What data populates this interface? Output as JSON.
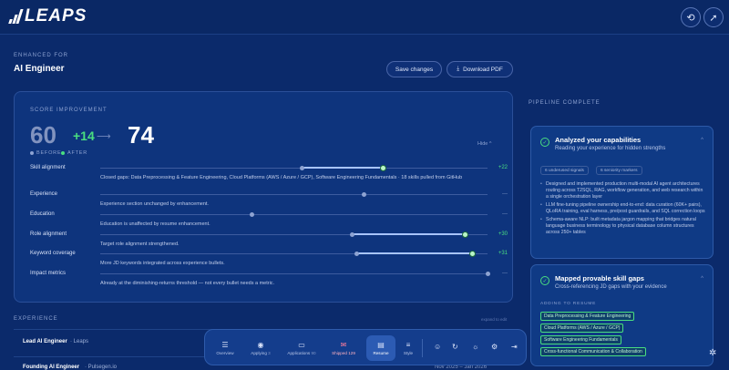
{
  "app": {
    "logo_text": "LEAPS"
  },
  "header": {
    "action1_icon": "refresh-icon",
    "action2_icon": "rocket-icon"
  },
  "page": {
    "eyebrow": "ENHANCED FOR",
    "role": "AI Engineer",
    "save_label": "Save changes",
    "download_label": "Download PDF"
  },
  "score": {
    "label": "SCORE IMPROVEMENT",
    "before": "60",
    "delta": "+14",
    "after": "74",
    "legend_before": "BEFORE",
    "legend_after": "AFTER",
    "hide_label": "Hide",
    "colors": {
      "before": "#8ea3d2",
      "after": "#4ade80"
    }
  },
  "metrics": [
    {
      "name": "Skill alignment",
      "before": 0.52,
      "after": 0.73,
      "delta": "+22",
      "note": "Closed gaps: Data Preprocessing & Feature Engineering, Cloud Platforms (AWS / Azure / GCP), Software Engineering Fundamentals · 18 skills pulled from GitHub"
    },
    {
      "name": "Experience",
      "before": 0.68,
      "after": null,
      "delta": "—",
      "note": "Experience section unchanged by enhancement."
    },
    {
      "name": "Education",
      "before": 0.39,
      "after": null,
      "delta": "—",
      "note": "Education is unaffected by resume enhancement."
    },
    {
      "name": "Role alignment",
      "before": 0.65,
      "after": 0.94,
      "delta": "+30",
      "note": "Target role alignment strengthened."
    },
    {
      "name": "Keyword coverage",
      "before": 0.66,
      "after": 0.96,
      "delta": "+31",
      "note": "More JD keywords integrated across experience bullets."
    },
    {
      "name": "Impact metrics",
      "before": 1.0,
      "after": null,
      "delta": "—",
      "note": "Already at the diminishing-returns threshold — not every bullet needs a metric."
    }
  ],
  "experience": {
    "label": "EXPERIENCE",
    "hint": "expand to edit",
    "rows": [
      {
        "title": "Lead AI Engineer",
        "company": "· Leaps",
        "dates": ""
      },
      {
        "title": "Founding AI Engineer",
        "company": "· Pulsegen.io",
        "dates": "Nov 2025 – Jan 2026"
      }
    ]
  },
  "pipeline": {
    "label": "PIPELINE COMPLETE",
    "step1": {
      "title": "Analyzed your capabilities",
      "subtitle": "Reading your experience for hidden strengths",
      "chips": [
        "6 underused signals",
        "6 seniority markers"
      ],
      "bullets": [
        "Designed and implemented production multi-modal AI agent architectures routing across T2SQL, RAG, workflow generation, and web research within a single orchestration layer",
        "LLM fine-tuning pipeline ownership end-to-end: data curation (60K+ pairs), QLoRA training, eval harness, pre/post guardrails, and SQL correction loops",
        "Schema-aware NLP: built metadata jargon mapping that bridges natural language business terminology to physical database column structures across 250+ tables"
      ]
    },
    "step2": {
      "title": "Mapped provable skill gaps",
      "subtitle": "Cross-referencing JD gaps with your evidence",
      "adding_label": "ADDING TO RESUME",
      "tags": [
        "Data Preprocessing & Feature Engineering",
        "Cloud Platforms (AWS / Azure / GCP)",
        "Software Engineering Fundamentals",
        "Cross-functional Communication & Collaboration"
      ]
    }
  },
  "dock": {
    "items": [
      {
        "label": "Overview",
        "count": "",
        "icon": "overview-icon"
      },
      {
        "label": "Applying",
        "count": "3",
        "icon": "broadcast-icon"
      },
      {
        "label": "Applications",
        "count": "90",
        "icon": "briefcase-icon"
      },
      {
        "label": "Shipped",
        "count": "129",
        "icon": "shipped-icon"
      },
      {
        "label": "Resume",
        "count": "",
        "icon": "resume-icon"
      },
      {
        "label": "Style",
        "count": "",
        "icon": "sliders-icon"
      }
    ],
    "active": "Resume"
  }
}
